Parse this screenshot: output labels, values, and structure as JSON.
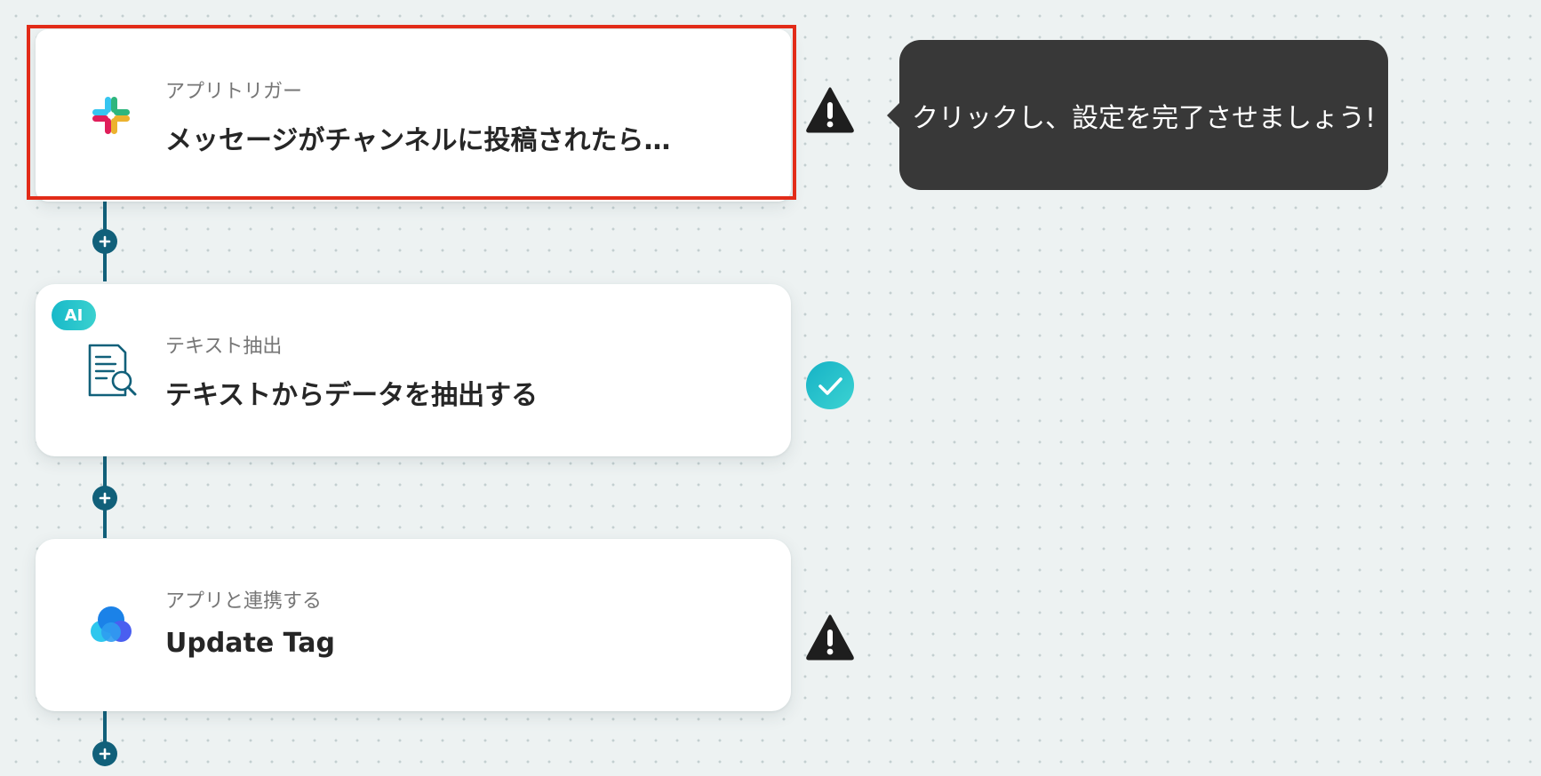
{
  "flow": {
    "steps": [
      {
        "subtitle": "アプリトリガー",
        "title": "メッセージがチャンネルに投稿されたら…",
        "icon": "slack-logo-icon",
        "status": "warning",
        "selected": true
      },
      {
        "badge": "AI",
        "subtitle": "テキスト抽出",
        "title": "テキストからデータを抽出する",
        "icon": "document-search-icon",
        "status": "complete"
      },
      {
        "subtitle": "アプリと連携する",
        "title": "Update Tag",
        "icon": "cloud-app-icon",
        "status": "warning"
      }
    ]
  },
  "tooltip": {
    "text": "クリックし、設定を完了させましょう!"
  },
  "colors": {
    "canvas": "#edf2f2",
    "connector": "#11607a",
    "selection_border": "#e22b18",
    "tooltip_bg": "#383838",
    "check_gradient_start": "#16b2c6",
    "check_gradient_end": "#3cd3d2",
    "warning": "#1e1e1e"
  }
}
